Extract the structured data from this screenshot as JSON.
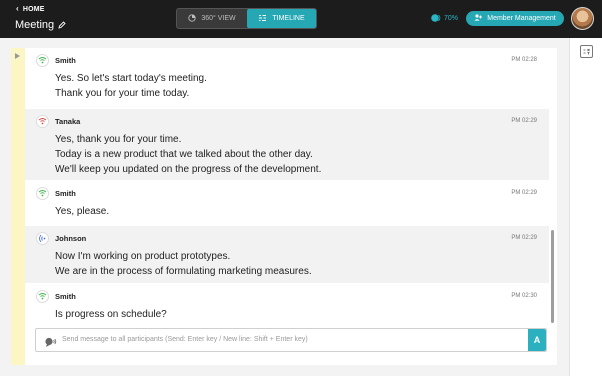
{
  "header": {
    "home_label": "HOME",
    "meeting_title": "Meeting",
    "view_360_label": "360° VIEW",
    "timeline_label": "TIMELINE",
    "signal_percent": "70%",
    "member_management_label": "Member Management"
  },
  "messages": [
    {
      "speaker": "Smith",
      "time": "PM 02:28",
      "lines": [
        "Yes. So let's start today's meeting.",
        "Thank you for your time today."
      ],
      "color": "#3cb54a"
    },
    {
      "speaker": "Tanaka",
      "time": "PM 02:29",
      "lines": [
        "Yes, thank you for your time.",
        "Today is a new product that we talked about the other day.",
        "We'll keep you updated on the progress of the development."
      ],
      "color": "#e24a4a"
    },
    {
      "speaker": "Smith",
      "time": "PM 02:29",
      "lines": [
        "Yes, please."
      ],
      "color": "#3cb54a"
    },
    {
      "speaker": "Johnson",
      "time": "PM 02:29",
      "lines": [
        "Now I'm working on product prototypes.",
        "We are in the process of formulating marketing measures."
      ],
      "color": "#4a6fe2"
    },
    {
      "speaker": "Smith",
      "time": "PM 02:30",
      "lines": [
        "Is progress on schedule?"
      ],
      "color": "#3cb54a"
    }
  ],
  "composer": {
    "placeholder": "Send message to all participants (Send: Enter key / New line: Shift + Enter key)",
    "send_label": "A"
  },
  "colors": {
    "accent": "#26a7b4",
    "topbar": "#1c1c1c",
    "timeline_stripe": "#fbf6c4"
  },
  "icons": [
    "chevron-left-icon",
    "pencil-icon",
    "360-view-icon",
    "timeline-icon",
    "signal-icon",
    "member-icon",
    "summary-icon",
    "play-icon",
    "speaker-icon",
    "send-icon"
  ]
}
